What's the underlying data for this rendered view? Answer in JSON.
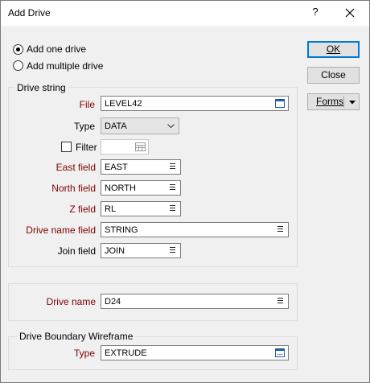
{
  "window": {
    "title": "Add Drive"
  },
  "titlebar": {
    "help": "?"
  },
  "mode": {
    "one_label": "Add one drive",
    "multiple_label": "Add multiple drive"
  },
  "drive_string": {
    "title": "Drive string",
    "file_label": "File",
    "file_value": "LEVEL42",
    "type_label": "Type",
    "type_value": "DATA",
    "filter_label": "Filter",
    "filter_value": "",
    "east_label": "East field",
    "east_value": "EAST",
    "north_label": "North field",
    "north_value": "NORTH",
    "z_label": "Z field",
    "z_value": "RL",
    "drive_name_field_label": "Drive name field",
    "drive_name_field_value": "STRING",
    "join_label": "Join field",
    "join_value": "JOIN"
  },
  "drive_name": {
    "label": "Drive name",
    "value": "D24"
  },
  "wireframe": {
    "title": "Drive Boundary Wireframe",
    "type_label": "Type",
    "type_value": "EXTRUDE"
  },
  "buttons": {
    "ok": "OK",
    "close": "Close",
    "forms": "Forms"
  }
}
